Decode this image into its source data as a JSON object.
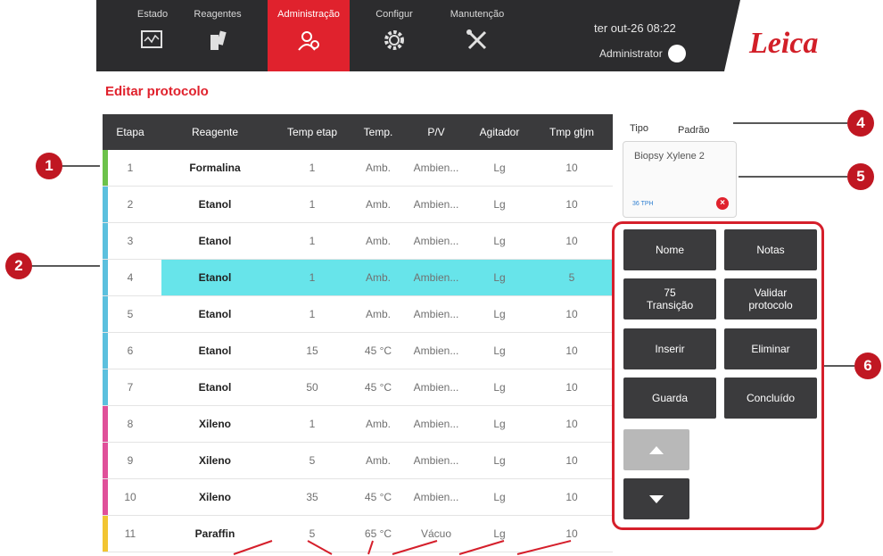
{
  "nav": {
    "tabs": [
      {
        "label": "Estado",
        "icon": "monitor-icon"
      },
      {
        "label": "Reagentes",
        "icon": "reagent-bottles-icon"
      },
      {
        "label": "Administração",
        "icon": "users-admin-icon",
        "active": true
      },
      {
        "label": "Configur",
        "icon": "gear-icon"
      },
      {
        "label": "Manutenção",
        "icon": "tools-icon"
      }
    ],
    "datetime": "ter out-26 08:22",
    "user": "Administrator",
    "logo": "Leica"
  },
  "page_title": "Editar protocolo",
  "table": {
    "headers": [
      "Etapa",
      "Reagente",
      "Temp etap",
      "Temp.",
      "P/V",
      "Agitador",
      "Tmp gtjm"
    ],
    "rows": [
      {
        "etapa": "1",
        "reagente": "Formalina",
        "temp_etap": "1",
        "temp": "Amb.",
        "pv": "Ambien...",
        "agitador": "Lg",
        "tmp": "10",
        "color": "#6cc24a"
      },
      {
        "etapa": "2",
        "reagente": "Etanol",
        "temp_etap": "1",
        "temp": "Amb.",
        "pv": "Ambien...",
        "agitador": "Lg",
        "tmp": "10",
        "color": "#5bc0de"
      },
      {
        "etapa": "3",
        "reagente": "Etanol",
        "temp_etap": "1",
        "temp": "Amb.",
        "pv": "Ambien...",
        "agitador": "Lg",
        "tmp": "10",
        "color": "#5bc0de"
      },
      {
        "etapa": "4",
        "reagente": "Etanol",
        "temp_etap": "1",
        "temp": "Amb.",
        "pv": "Ambien...",
        "agitador": "Lg",
        "tmp": "5",
        "color": "#5bc0de",
        "selected": true
      },
      {
        "etapa": "5",
        "reagente": "Etanol",
        "temp_etap": "1",
        "temp": "Amb.",
        "pv": "Ambien...",
        "agitador": "Lg",
        "tmp": "10",
        "color": "#5bc0de"
      },
      {
        "etapa": "6",
        "reagente": "Etanol",
        "temp_etap": "15",
        "temp": "45 °C",
        "pv": "Ambien...",
        "agitador": "Lg",
        "tmp": "10",
        "color": "#5bc0de"
      },
      {
        "etapa": "7",
        "reagente": "Etanol",
        "temp_etap": "50",
        "temp": "45 °C",
        "pv": "Ambien...",
        "agitador": "Lg",
        "tmp": "10",
        "color": "#5bc0de"
      },
      {
        "etapa": "8",
        "reagente": "Xileno",
        "temp_etap": "1",
        "temp": "Amb.",
        "pv": "Ambien...",
        "agitador": "Lg",
        "tmp": "10",
        "color": "#e0509a"
      },
      {
        "etapa": "9",
        "reagente": "Xileno",
        "temp_etap": "5",
        "temp": "Amb.",
        "pv": "Ambien...",
        "agitador": "Lg",
        "tmp": "10",
        "color": "#e0509a"
      },
      {
        "etapa": "10",
        "reagente": "Xileno",
        "temp_etap": "35",
        "temp": "45 °C",
        "pv": "Ambien...",
        "agitador": "Lg",
        "tmp": "10",
        "color": "#e0509a"
      },
      {
        "etapa": "11",
        "reagente": "Paraffin",
        "temp_etap": "5",
        "temp": "65 °C",
        "pv": "Vácuo",
        "agitador": "Lg",
        "tmp": "10",
        "color": "#f2c531"
      }
    ]
  },
  "tipo": {
    "label": "Tipo",
    "value": "Padrão"
  },
  "reagent_card": {
    "name": "Biopsy Xylene 2",
    "small": "36 TPH"
  },
  "buttons": {
    "nome": "Nome",
    "notas": "Notas",
    "transicao_value": "75",
    "transicao_label": "Transição",
    "validar_l1": "Validar",
    "validar_l2": "protocolo",
    "inserir": "Inserir",
    "eliminar": "Eliminar",
    "guarda": "Guarda",
    "concluido": "Concluído"
  },
  "callouts": [
    "1",
    "2",
    "4",
    "5",
    "6"
  ]
}
